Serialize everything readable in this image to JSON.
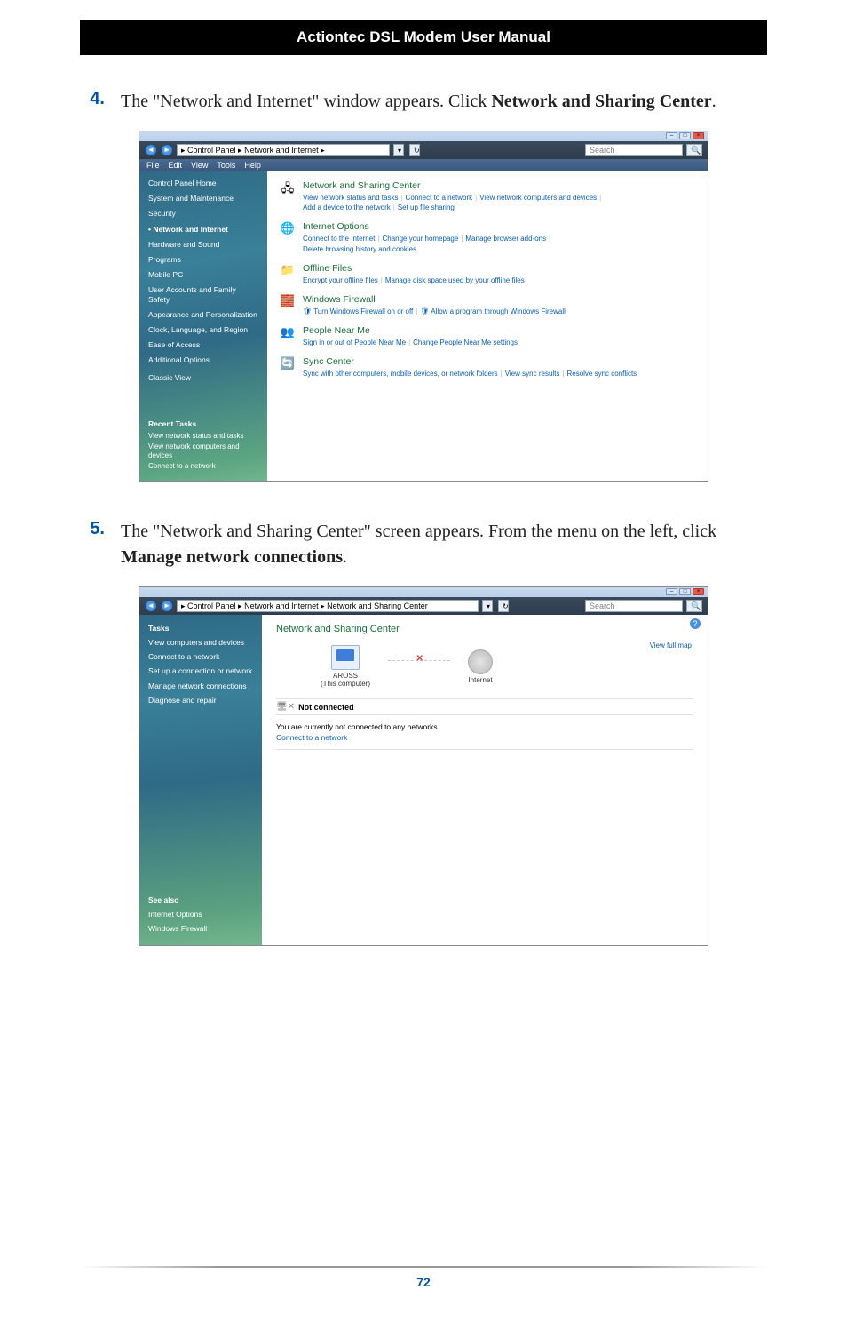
{
  "header": {
    "title": "Actiontec DSL Modem User Manual"
  },
  "steps": {
    "s4": {
      "num": "4.",
      "text_a": "The \"Network and Internet\" window appears.  Click ",
      "bold": "Network and Sharing Center",
      "text_b": "."
    },
    "s5": {
      "num": "5.",
      "text_a": "The \"Network and Sharing Center\" screen appears. From the menu on the left, click ",
      "bold": "Manage network connections",
      "text_b": "."
    }
  },
  "footer": {
    "page": "72"
  },
  "shot1": {
    "breadcrumb": " ▸ Control Panel ▸ Network and Internet ▸",
    "search_placeholder": "Search",
    "menu": [
      "File",
      "Edit",
      "View",
      "Tools",
      "Help"
    ],
    "sidebar": {
      "home": "Control Panel Home",
      "items": [
        "System and Maintenance",
        "Security",
        "Network and Internet",
        "Hardware and Sound",
        "Programs",
        "Mobile PC",
        "User Accounts and Family Safety",
        "Appearance and Personalization",
        "Clock, Language, and Region",
        "Ease of Access",
        "Additional Options"
      ],
      "classic": "Classic View",
      "recent_h": "Recent Tasks",
      "recent": [
        "View network status and tasks",
        "View network computers and devices",
        "Connect to a network"
      ]
    },
    "cats": [
      {
        "title": "Network and Sharing Center",
        "links": [
          "View network status and tasks",
          "Connect to a network",
          "View network computers and devices",
          "Add a device to the network",
          "Set up file sharing"
        ]
      },
      {
        "title": "Internet Options",
        "links": [
          "Connect to the Internet",
          "Change your homepage",
          "Manage browser add-ons",
          "Delete browsing history and cookies"
        ]
      },
      {
        "title": "Offline Files",
        "links": [
          "Encrypt your offline files",
          "Manage disk space used by your offline files"
        ]
      },
      {
        "title": "Windows Firewall",
        "links": [
          "Turn Windows Firewall on or off",
          "Allow a program through Windows Firewall"
        ]
      },
      {
        "title": "People Near Me",
        "links": [
          "Sign in or out of People Near Me",
          "Change People Near Me settings"
        ]
      },
      {
        "title": "Sync Center",
        "links": [
          "Sync with other computers, mobile devices, or network folders",
          "View sync results",
          "Resolve sync conflicts"
        ]
      }
    ]
  },
  "shot2": {
    "breadcrumb": " ▸ Control Panel ▸ Network and Internet ▸ Network and Sharing Center",
    "search_placeholder": "Search",
    "sidebar": {
      "tasks_h": "Tasks",
      "tasks": [
        "View computers and devices",
        "Connect to a network",
        "Set up a connection or network",
        "Manage network connections",
        "Diagnose and repair"
      ],
      "seealso_h": "See also",
      "seealso": [
        "Internet Options",
        "Windows Firewall"
      ]
    },
    "main": {
      "title": "Network and Sharing Center",
      "viewmap": "View full map",
      "pc_name": "AROSS",
      "pc_sub": "(This computer)",
      "inet": "Internet",
      "status_head": "Not connected",
      "status_msg": "You are currently not connected to any networks.",
      "status_link": "Connect to a network"
    }
  }
}
